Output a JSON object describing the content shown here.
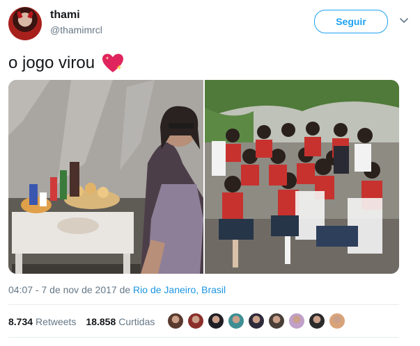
{
  "user": {
    "name": "thami",
    "handle": "@thamimrcl"
  },
  "follow_label": "Seguir",
  "tweet": {
    "text": "o jogo virou",
    "emoji": "sparkling-heart"
  },
  "meta": {
    "time": "04:07 - 7 de nov de 2017",
    "connector": " de ",
    "location": "Rio de Janeiro, Brasil"
  },
  "stats": {
    "retweets": {
      "count": "8.734",
      "label": "Retweets"
    },
    "likes": {
      "count": "18.858",
      "label": "Curtidas"
    }
  },
  "likers": [
    {
      "icon": "avatar-1",
      "color": "#5a3a2e"
    },
    {
      "icon": "avatar-2",
      "color": "#8b2f2a"
    },
    {
      "icon": "avatar-3",
      "color": "#1e1e24"
    },
    {
      "icon": "avatar-4",
      "color": "#3e8e93"
    },
    {
      "icon": "avatar-5",
      "color": "#2d2a3a"
    },
    {
      "icon": "avatar-6",
      "color": "#4a3f38"
    },
    {
      "icon": "avatar-7",
      "color": "#c0a0c8"
    },
    {
      "icon": "avatar-8",
      "color": "#2b2b2b"
    },
    {
      "icon": "avatar-9",
      "color": "#d9a37a"
    }
  ],
  "colors": {
    "accent": "#1da1f2",
    "link": "#1b95e0",
    "muted": "#657786",
    "heart": "#e0245e"
  }
}
